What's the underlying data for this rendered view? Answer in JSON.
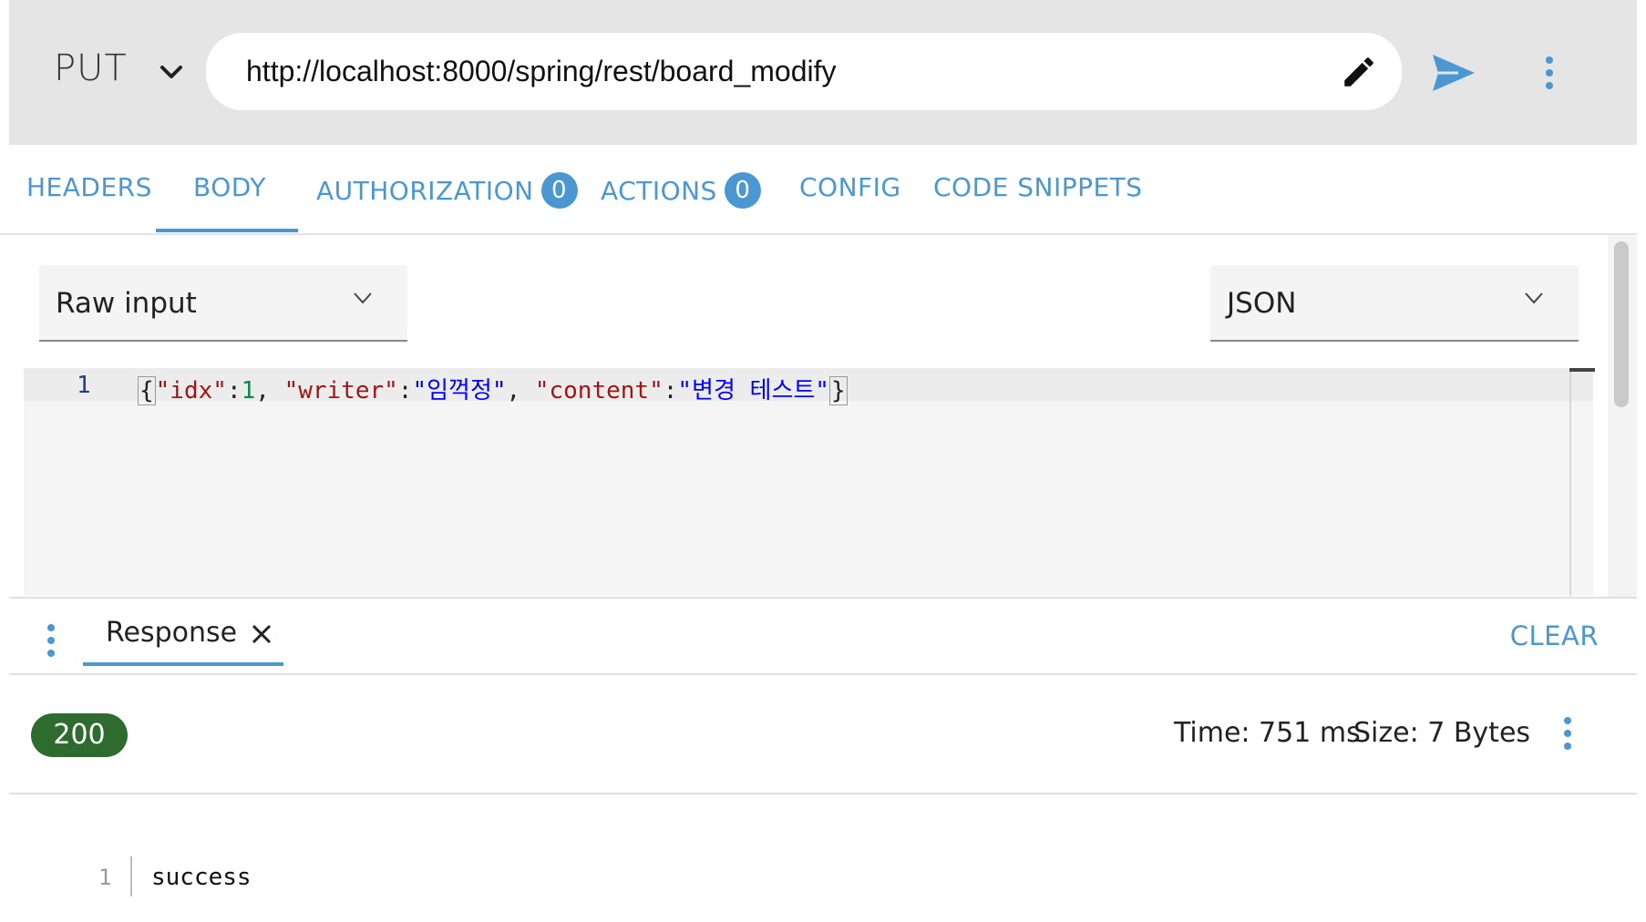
{
  "request": {
    "method": "PUT",
    "url": "http://localhost:8000/spring/rest/board_modify"
  },
  "tabs": [
    {
      "label": "HEADERS"
    },
    {
      "label": "BODY",
      "active": true
    },
    {
      "label": "AUTHORIZATION",
      "badge": "0"
    },
    {
      "label": "ACTIONS",
      "badge": "0"
    },
    {
      "label": "CONFIG"
    },
    {
      "label": "CODE SNIPPETS"
    }
  ],
  "body": {
    "input_type": "Raw input",
    "content_type": "JSON",
    "line_number": "1",
    "code": {
      "open": "{",
      "k1": "\"idx\"",
      "colon": ":",
      "v1": "1",
      "comma": ", ",
      "k2": "\"writer\"",
      "v2": "\"임꺽정\"",
      "k3": "\"content\"",
      "v3": "\"변경 테스트\"",
      "close": "}"
    }
  },
  "response": {
    "tab_label": "Response",
    "clear_label": "CLEAR",
    "status_code": "200",
    "time_text": "Time: 751 ms",
    "size_text": "Size: 7 Bytes",
    "line_number": "1",
    "body_text": "success"
  },
  "colors": {
    "accent": "#4a97d1",
    "status_ok": "#2e6b2e",
    "header_bg": "#e5e5e5"
  },
  "icons": [
    "chevron-down-icon",
    "edit-pencil-icon",
    "send-icon",
    "kebab-menu-icon",
    "close-icon"
  ]
}
